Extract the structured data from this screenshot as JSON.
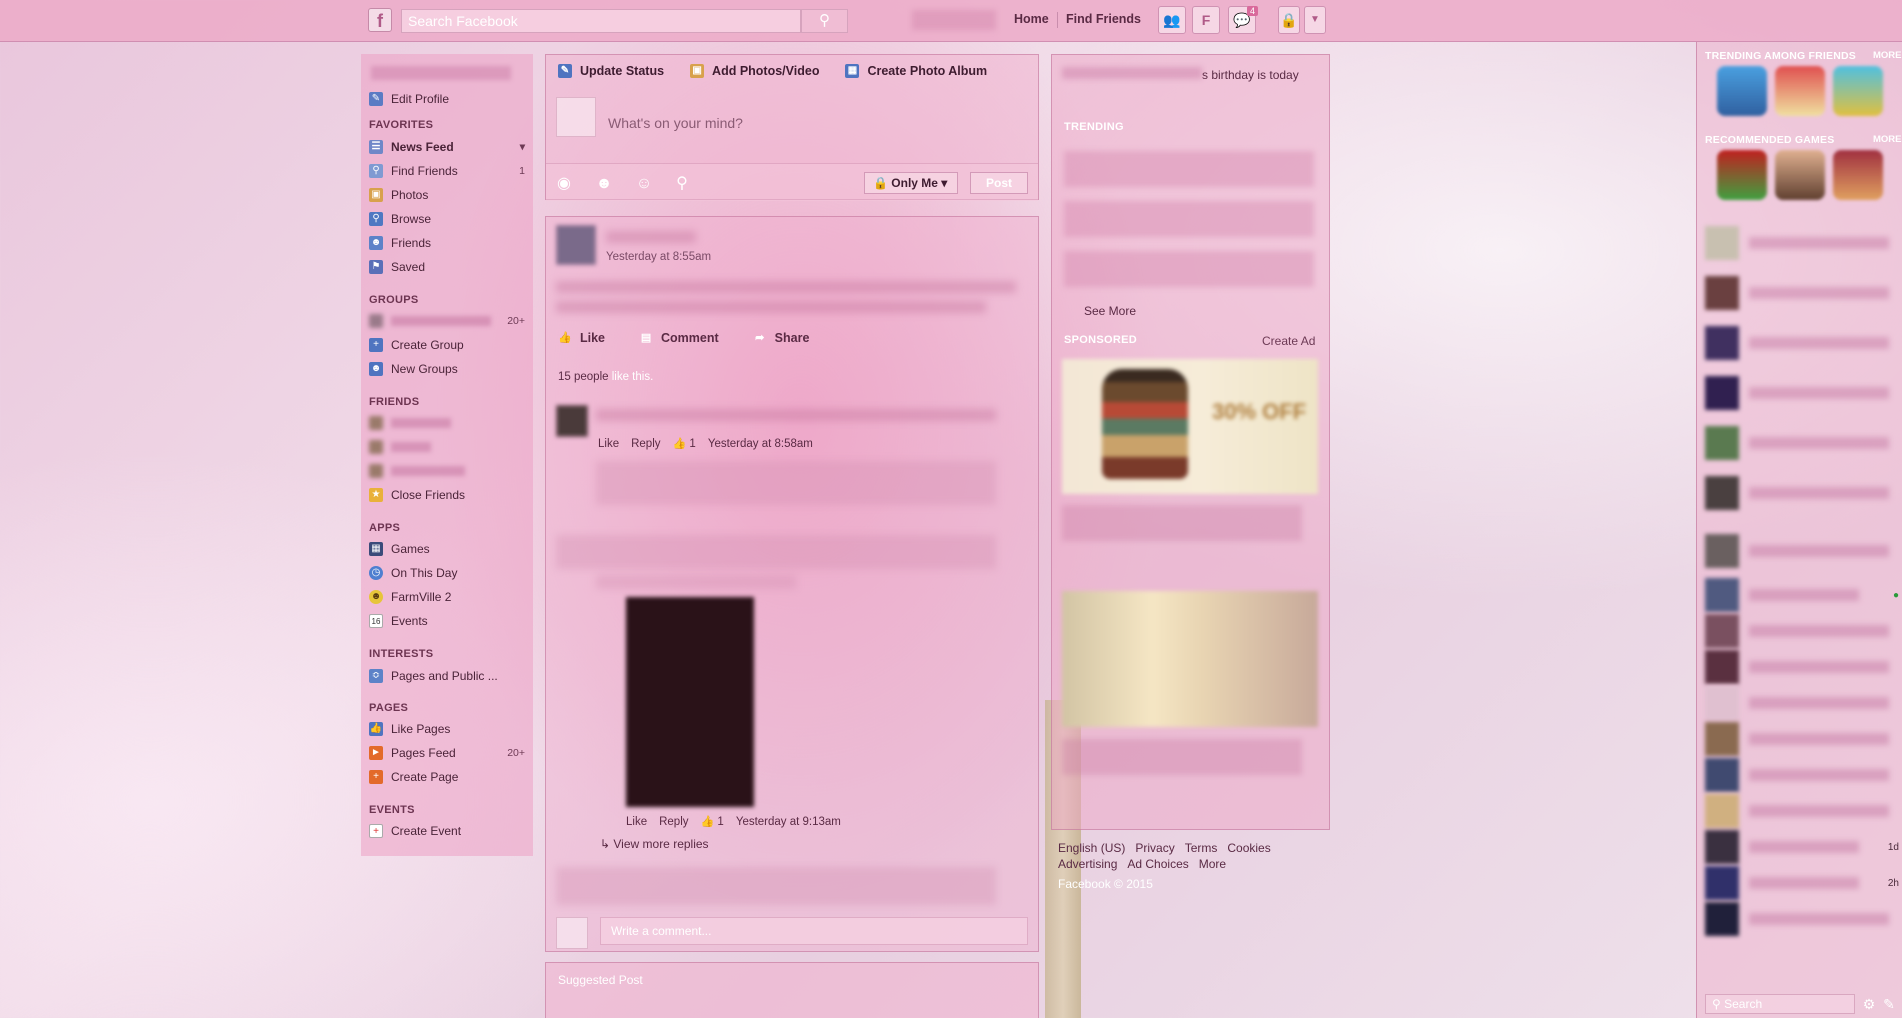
{
  "topbar": {
    "logo": "f",
    "search_placeholder": "Search Facebook",
    "nav_home": "Home",
    "nav_find_friends": "Find Friends",
    "profile_letter": "F",
    "messages_badge": "4"
  },
  "left": {
    "edit_profile": "Edit Profile",
    "favorites_head": "FAVORITES",
    "news_feed": "News Feed",
    "find_friends": "Find Friends",
    "find_friends_count": "1",
    "photos": "Photos",
    "browse": "Browse",
    "friends": "Friends",
    "saved": "Saved",
    "groups_head": "GROUPS",
    "group_count": "20+",
    "create_group": "Create Group",
    "new_groups": "New Groups",
    "friends_head": "FRIENDS",
    "close_friends": "Close Friends",
    "apps_head": "APPS",
    "games": "Games",
    "on_this_day": "On This Day",
    "farmville": "FarmVille 2",
    "events": "Events",
    "events_icon_num": "16",
    "interests_head": "INTERESTS",
    "pages_public": "Pages and Public ...",
    "pages_head": "PAGES",
    "like_pages": "Like Pages",
    "pages_feed": "Pages Feed",
    "pages_feed_count": "20+",
    "create_page": "Create Page",
    "events_head": "EVENTS",
    "create_event": "Create Event"
  },
  "composer": {
    "tab_status": "Update Status",
    "tab_photos": "Add Photos/Video",
    "tab_album": "Create Photo Album",
    "placeholder": "What's on your mind?",
    "privacy": "Only Me",
    "post": "Post"
  },
  "story": {
    "time": "Yesterday at 8:55am",
    "like": "Like",
    "comment": "Comment",
    "share": "Share",
    "likes_count": "15 people",
    "likes_suffix": " like this.",
    "c1_like": "Like",
    "c1_reply": "Reply",
    "c1_count": "1",
    "c1_time": "Yesterday at 8:58am",
    "c2_like": "Like",
    "c2_reply": "Reply",
    "c2_count": "1",
    "c2_time": "Yesterday at 9:13am",
    "view_more": "View more replies",
    "write_comment": "Write a comment..."
  },
  "suggested": {
    "title": "Suggested Post"
  },
  "right": {
    "bday_suffix": "s birthday is today",
    "trending_head": "TRENDING",
    "see_more": "See More",
    "sponsored_head": "SPONSORED",
    "create_ad": "Create Ad",
    "ad1_sale": "30% OFF"
  },
  "footer": {
    "english": "English (US)",
    "privacy": "Privacy",
    "terms": "Terms",
    "cookies": "Cookies",
    "advertising": "Advertising",
    "ad_choices": "Ad Choices",
    "more": "More",
    "copyright": "Facebook © 2015"
  },
  "chat": {
    "trending_head": "TRENDING AMONG FRIENDS",
    "more1": "MORE",
    "recommended_head": "RECOMMENDED GAMES",
    "more2": "MORE",
    "status_1d": "1d",
    "status_2h": "2h",
    "search_placeholder": "Search"
  },
  "colors": {
    "accent": "#d96a9c",
    "panel": "#eea6c6"
  }
}
